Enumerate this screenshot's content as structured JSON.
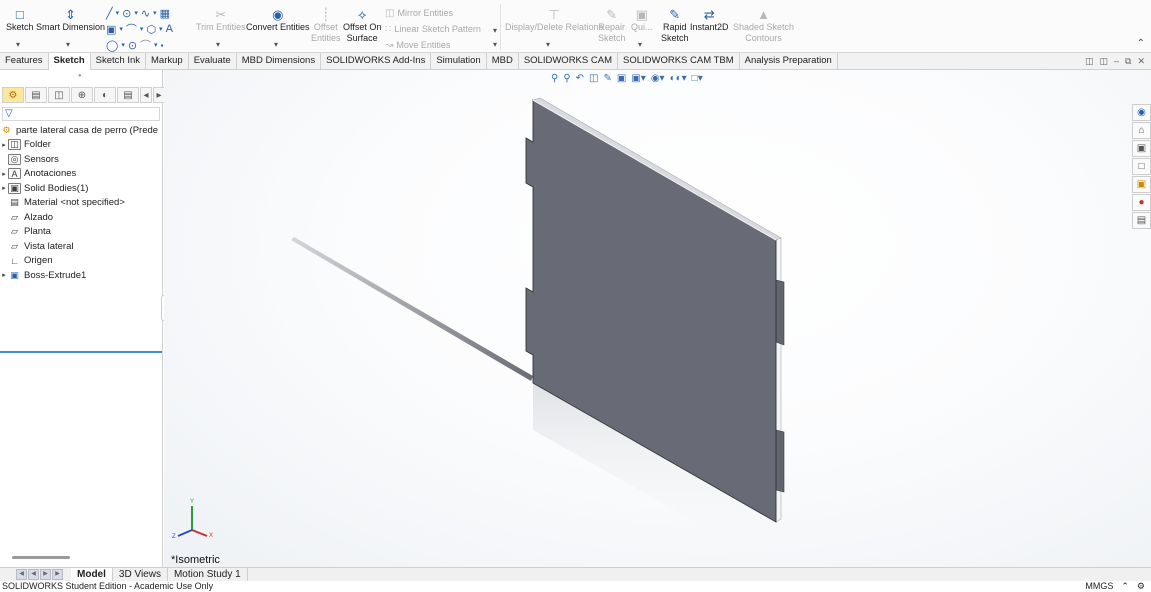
{
  "ribbon": {
    "sketch": "Sketch",
    "smart_dimension": "Smart Dimension",
    "trim_entities": "Trim Entities",
    "convert_entities": "Convert Entities",
    "offset_entities": [
      "Offset",
      "Entities"
    ],
    "offset_on_surface": [
      "Offset On",
      "Surface"
    ],
    "mirror_entities": "Mirror Entities",
    "linear_sketch_pattern": "Linear Sketch Pattern",
    "move_entities": "Move Entities",
    "display_delete_relations": "Display/Delete Relations",
    "repair_sketch": [
      "Repair",
      "Sketch"
    ],
    "quick_snaps": "Qui...",
    "rapid_sketch": [
      "Rapid",
      "Sketch"
    ],
    "instant2d": "Instant2D",
    "shaded_sketch_contours": [
      "Shaded Sketch",
      "Contours"
    ]
  },
  "tabs": [
    "Features",
    "Sketch",
    "Sketch Ink",
    "Markup",
    "Evaluate",
    "MBD Dimensions",
    "SOLIDWORKS Add-Ins",
    "Simulation",
    "MBD",
    "SOLIDWORKS CAM",
    "SOLIDWORKS CAM TBM",
    "Analysis Preparation"
  ],
  "active_tab": "Sketch",
  "tree": {
    "root": "parte lateral casa de perro (Prede",
    "items": [
      {
        "label": "Folder",
        "expandable": true,
        "icon": "folder-icon"
      },
      {
        "label": "Sensors",
        "expandable": false,
        "icon": "sensor-icon"
      },
      {
        "label": "Anotaciones",
        "expandable": true,
        "icon": "annotations-icon"
      },
      {
        "label": "Solid Bodies(1)",
        "expandable": true,
        "icon": "solid-bodies-icon"
      },
      {
        "label": "Material <not specified>",
        "expandable": false,
        "icon": "material-icon"
      },
      {
        "label": "Alzado",
        "expandable": false,
        "icon": "plane-icon"
      },
      {
        "label": "Planta",
        "expandable": false,
        "icon": "plane-icon"
      },
      {
        "label": "Vista lateral",
        "expandable": false,
        "icon": "plane-icon"
      },
      {
        "label": "Origen",
        "expandable": false,
        "icon": "origin-icon"
      },
      {
        "label": "Boss-Extrude1",
        "expandable": true,
        "icon": "extrude-icon"
      }
    ]
  },
  "viewport": {
    "view_name": "*Isometric",
    "triad": {
      "x": "X",
      "y": "Y",
      "z": "Z"
    }
  },
  "bottom_tabs": [
    "Model",
    "3D Views",
    "Motion Study 1"
  ],
  "active_bottom_tab": "Model",
  "status": {
    "left": "SOLIDWORKS Student Edition - Academic Use Only",
    "units": "MMGS"
  },
  "colors": {
    "accent": "#3d8fd1",
    "part_front": "#686b75",
    "part_edge": "#e4e6ea"
  }
}
